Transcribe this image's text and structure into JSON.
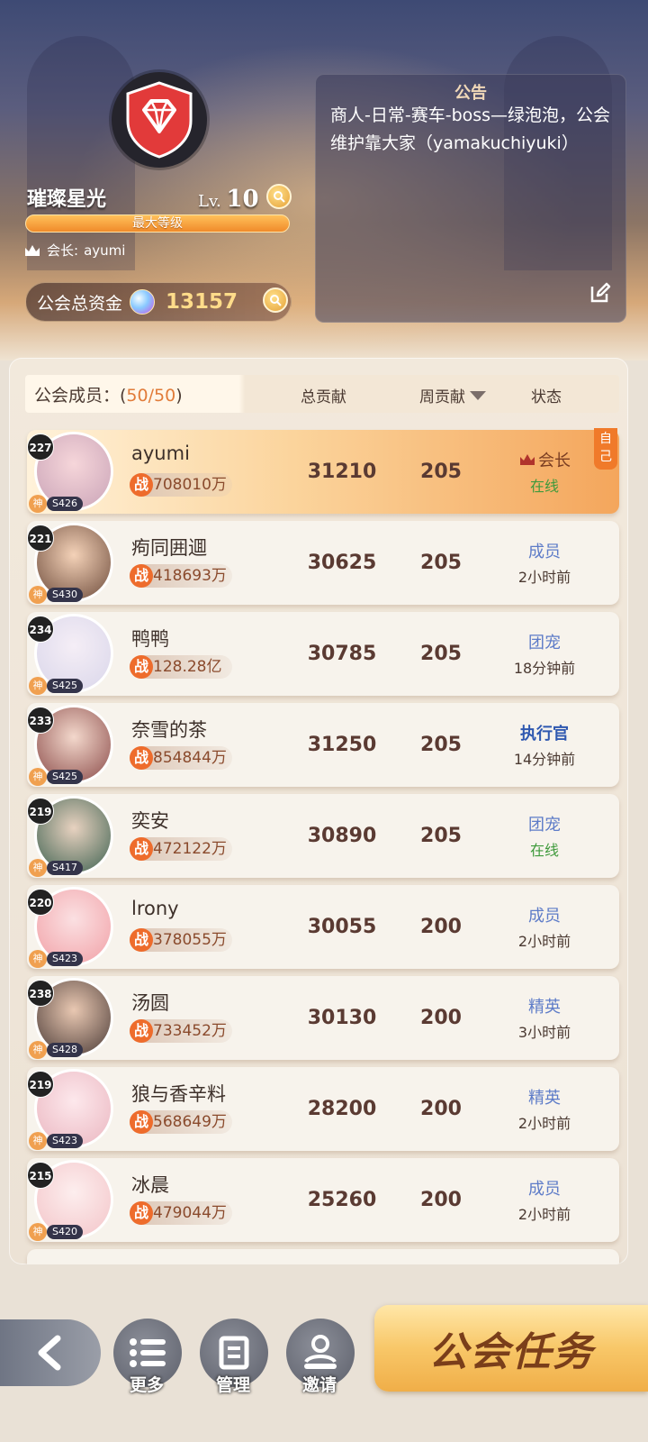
{
  "guild": {
    "name": "璀璨星光",
    "level_prefix": "Lv.",
    "level": "10",
    "max_level_label": "最大等级",
    "leader_label": "会长:",
    "leader_name": "ayumi",
    "funds_label": "公会总资金",
    "funds_value": "13157"
  },
  "notice": {
    "title": "公告",
    "text": "商人-日常-赛车-boss—绿泡泡，公会维护靠大家（yamakuchiyuki）"
  },
  "members_header": {
    "label": "公会成员：(",
    "count": "50/50",
    "close": ")",
    "col_total": "总贡献",
    "col_weekly": "周贡献",
    "col_status": "状态"
  },
  "self_tag": "自己",
  "power_prefix": "战",
  "members": [
    {
      "level": "227",
      "server": "S426",
      "name": "ayumi",
      "power": "708010万",
      "total": "31210",
      "weekly": "205",
      "role": "会长",
      "time": "在线",
      "color": "#c9a3b7"
    },
    {
      "level": "221",
      "server": "S430",
      "name": "痀同囲逥",
      "power": "418693万",
      "total": "30625",
      "weekly": "205",
      "role": "成员",
      "time": "2小时前",
      "color": "#6c4a3a"
    },
    {
      "level": "234",
      "server": "S425",
      "name": "鸭鸭",
      "power": "128.28亿",
      "total": "30785",
      "weekly": "205",
      "role": "团宠",
      "time": "18分钟前",
      "color": "#d9d6ea"
    },
    {
      "level": "233",
      "server": "S425",
      "name": "奈雪的茶",
      "power": "854844万",
      "total": "31250",
      "weekly": "205",
      "role": "执行官",
      "time": "14分钟前",
      "color": "#8a4a48"
    },
    {
      "level": "219",
      "server": "S417",
      "name": "奕安",
      "power": "472122万",
      "total": "30890",
      "weekly": "205",
      "role": "团宠",
      "time": "在线",
      "color": "#3d6150"
    },
    {
      "level": "220",
      "server": "S423",
      "name": "lrony",
      "power": "378055万",
      "total": "30055",
      "weekly": "200",
      "role": "成员",
      "time": "2小时前",
      "color": "#f1a0a6"
    },
    {
      "level": "238",
      "server": "S428",
      "name": "汤圆",
      "power": "733452万",
      "total": "30130",
      "weekly": "200",
      "role": "精英",
      "time": "3小时前",
      "color": "#4a3a36"
    },
    {
      "level": "219",
      "server": "S423",
      "name": "狼与香辛料",
      "power": "568649万",
      "total": "28200",
      "weekly": "200",
      "role": "精英",
      "time": "2小时前",
      "color": "#eab6c0"
    },
    {
      "level": "215",
      "server": "S420",
      "name": "冰晨",
      "power": "479044万",
      "total": "25260",
      "weekly": "200",
      "role": "成员",
      "time": "2小时前",
      "color": "#f3c4c8"
    }
  ],
  "bottom": {
    "more_label": "更多",
    "manage_label": "管理",
    "invite_label": "邀请",
    "quest_label": "公会任务"
  }
}
